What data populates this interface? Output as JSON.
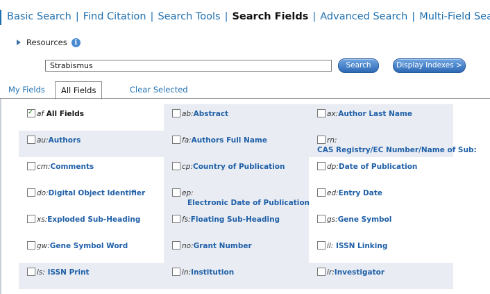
{
  "nav": {
    "items": [
      {
        "label": "Basic Search",
        "active": false
      },
      {
        "label": "Find Citation",
        "active": false
      },
      {
        "label": "Search Tools",
        "active": false
      },
      {
        "label": "Search Fields",
        "active": true
      },
      {
        "label": "Advanced Search",
        "active": false
      },
      {
        "label": "Multi-Field Search",
        "active": false
      }
    ],
    "separator": "|"
  },
  "resources": {
    "label": "Resources",
    "info_icon": "i"
  },
  "search": {
    "value": "Strabismus",
    "search_button": "Search",
    "display_indexes_button": "Display Indexes >"
  },
  "tabs": {
    "my_fields": "My Fields",
    "all_fields": "All Fields",
    "clear_selected": "Clear Selected"
  },
  "fields": [
    [
      {
        "code": "af",
        "name": "All Fields",
        "checked": true
      },
      {
        "code": "ab:",
        "name": "Abstract",
        "checked": false
      },
      {
        "code": "ax:",
        "name": "Author Last Name",
        "checked": false
      }
    ],
    [
      {
        "code": "au:",
        "name": "Authors",
        "checked": false
      },
      {
        "code": "fa:",
        "name": "Authors Full Name",
        "checked": false
      },
      {
        "code": "rn:",
        "name": "CAS Registry/EC Number/Name of Sub:",
        "checked": false
      }
    ],
    [
      {
        "code": "cm:",
        "name": "Comments",
        "checked": false
      },
      {
        "code": "cp:",
        "name": "Country of Publication",
        "checked": false
      },
      {
        "code": "dp:",
        "name": "Date of Publication",
        "checked": false
      }
    ],
    [
      {
        "code": "do:",
        "name": "Digital Object Identifier",
        "checked": false
      },
      {
        "code": "ep:",
        "name": "Electronic Date of Publication",
        "checked": false
      },
      {
        "code": "ed:",
        "name": "Entry Date",
        "checked": false
      }
    ],
    [
      {
        "code": "xs:",
        "name": "Exploded Sub-Heading",
        "checked": false
      },
      {
        "code": "fs:",
        "name": "Floating Sub-Heading",
        "checked": false
      },
      {
        "code": "gs:",
        "name": "Gene Symbol",
        "checked": false
      }
    ],
    [
      {
        "code": "gw:",
        "name": "Gene Symbol Word",
        "checked": false
      },
      {
        "code": "no:",
        "name": "Grant Number",
        "checked": false
      },
      {
        "code": "il:",
        "name": " ISSN Linking",
        "checked": false
      }
    ],
    [
      {
        "code": "is:",
        "name": " ISSN Print",
        "checked": false
      },
      {
        "code": "in:",
        "name": "Institution",
        "checked": false
      },
      {
        "code": "ir:",
        "name": "Investigator",
        "checked": false
      }
    ]
  ],
  "colors": {
    "link": "#2070b0",
    "shade": "#e9edf3",
    "button": "#2d69b4"
  }
}
